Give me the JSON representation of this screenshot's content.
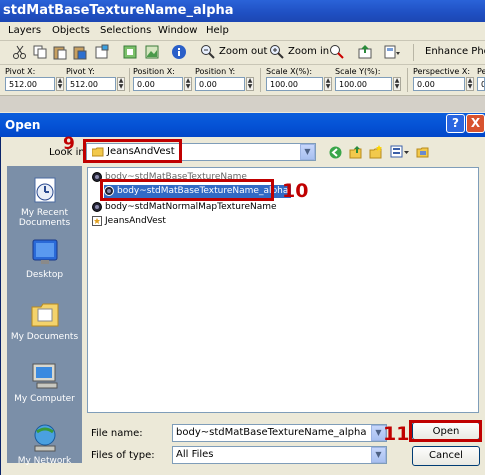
{
  "app": {
    "title": "stdMatBaseTextureName_alpha",
    "menu": [
      "Layers",
      "Objects",
      "Selections",
      "Window",
      "Help"
    ],
    "toolbar": {
      "zoom_out_label": "Zoom out",
      "zoom_in_label": "Zoom in",
      "enhance_label": "Enhance Photo"
    },
    "transform": [
      {
        "label": "Pivot X:",
        "value": "512.00"
      },
      {
        "label": "Pivot Y:",
        "value": "512.00"
      },
      {
        "label": "Position X:",
        "value": "0.00"
      },
      {
        "label": "Position Y:",
        "value": "0.00"
      },
      {
        "label": "Scale X(%):",
        "value": "100.00"
      },
      {
        "label": "Scale Y(%):",
        "value": "100.00"
      },
      {
        "label": "Perspective X:",
        "value": "0.00"
      },
      {
        "label": "Pe",
        "value": "0"
      }
    ]
  },
  "dialog": {
    "title": "Open",
    "help_btn": "?",
    "close_btn": "X",
    "look_in_label": "Look in:",
    "look_in_value": "JeansAndVest",
    "places": [
      "My Recent Documents",
      "Desktop",
      "My Documents",
      "My Computer",
      "My Network"
    ],
    "files": [
      "body~stdMatBaseTextureName",
      "body~stdMatBaseTextureName_alpha",
      "body~stdMatNormalMapTextureName",
      "JeansAndVest"
    ],
    "selected_index": 1,
    "file_name_label": "File name:",
    "file_name_value": "body~stdMatBaseTextureName_alpha",
    "files_of_type_label": "Files of type:",
    "files_of_type_value": "All Files",
    "open_button": "Open",
    "cancel_button": "Cancel"
  },
  "annotations": {
    "step_lookin": "9",
    "step_file": "10",
    "step_open": "11"
  },
  "colors": {
    "annotation_red": "#c00000",
    "selection_blue": "#316ac5",
    "xp_title_blue": "#0553d6"
  }
}
